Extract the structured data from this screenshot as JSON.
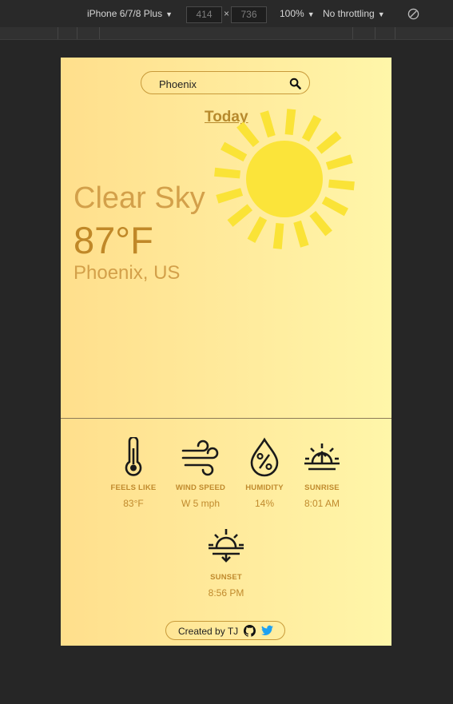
{
  "devtools": {
    "device": "iPhone 6/7/8 Plus",
    "width": "414",
    "height": "736",
    "separator": "×",
    "zoom": "100%",
    "throttling": "No throttling"
  },
  "search": {
    "value": "Phoenix"
  },
  "today_label": "Today",
  "weather": {
    "condition": "Clear Sky",
    "temperature": "87°F",
    "location": "Phoenix, US"
  },
  "stats": [
    {
      "label": "FEELS LIKE",
      "value": "83°F",
      "icon": "thermometer-icon"
    },
    {
      "label": "WIND SPEED",
      "value": "W 5 mph",
      "icon": "wind-icon"
    },
    {
      "label": "HUMIDITY",
      "value": "14%",
      "icon": "humidity-icon"
    },
    {
      "label": "SUNRISE",
      "value": "8:01 AM",
      "icon": "sunrise-icon"
    },
    {
      "label": "SUNSET",
      "value": "8:56 PM",
      "icon": "sunset-icon"
    }
  ],
  "footer": {
    "credit": "Created by TJ"
  },
  "colors": {
    "accent": "#c08a2d",
    "sun": "#fbe43a",
    "sun_rays": "#fae337"
  }
}
